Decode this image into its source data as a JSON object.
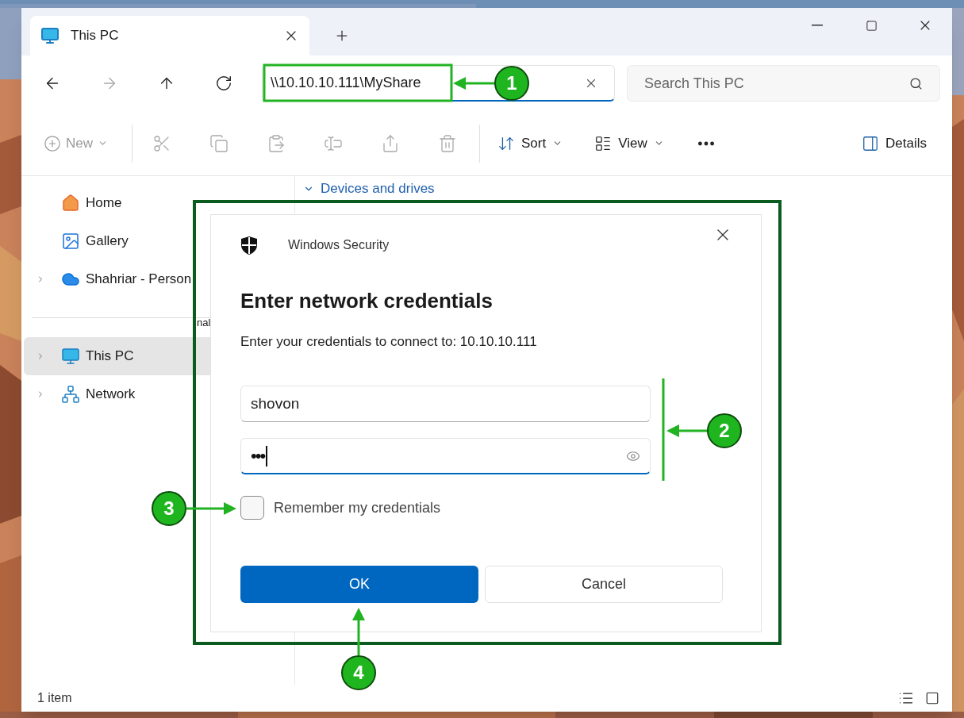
{
  "tab": {
    "title": "This PC",
    "selected": true
  },
  "navigation": [
    {
      "kind": "back",
      "disabled": false
    },
    {
      "kind": "forward",
      "disabled": true
    },
    {
      "kind": "up",
      "disabled": false
    },
    {
      "kind": "refresh",
      "disabled": false
    }
  ],
  "address_bar": {
    "value": "\\\\10.10.10.111\\MyShare",
    "focused": true
  },
  "search": {
    "placeholder": "Search This PC"
  },
  "toolbar": {
    "new": {
      "label": "New",
      "disabled": true
    },
    "actions": [
      {
        "kind": "cut",
        "disabled": true
      },
      {
        "kind": "copy",
        "disabled": true
      },
      {
        "kind": "paste",
        "disabled": true
      },
      {
        "kind": "rename",
        "disabled": true
      },
      {
        "kind": "share",
        "disabled": true
      },
      {
        "kind": "delete",
        "disabled": true
      }
    ],
    "sort": {
      "label": "Sort"
    },
    "view": {
      "label": "View"
    },
    "details": {
      "label": "Details"
    }
  },
  "sidebar": {
    "groups": [
      {
        "items": [
          {
            "kind": "home",
            "label": "Home",
            "expandable": false,
            "selected": false
          },
          {
            "kind": "gallery",
            "label": "Gallery",
            "expandable": false,
            "selected": false
          },
          {
            "kind": "cloud",
            "label": "Shahriar - Person",
            "expandable": true,
            "selected": false
          }
        ]
      },
      {
        "items": [
          {
            "kind": "pc",
            "label": "This PC",
            "expandable": true,
            "selected": true
          },
          {
            "kind": "network",
            "label": "Network",
            "expandable": true,
            "selected": false
          }
        ]
      }
    ]
  },
  "main": {
    "section": {
      "label": "Devices and drives",
      "expanded": true
    },
    "fragment": "nal"
  },
  "dialog": {
    "app": "Windows Security",
    "title": "Enter network credentials",
    "message": "Enter your credentials to connect to: 10.10.10.111",
    "username": {
      "value": "shovon",
      "focused": false
    },
    "password": {
      "value": "•••",
      "focused": true
    },
    "remember": {
      "label": "Remember my credentials",
      "checked": false
    },
    "buttons": [
      {
        "label": "OK",
        "kind": "primary"
      },
      {
        "label": "Cancel",
        "kind": "secondary"
      }
    ]
  },
  "annotations": [
    {
      "number": "1"
    },
    {
      "number": "2"
    },
    {
      "number": "3"
    },
    {
      "number": "4"
    }
  ],
  "status_bar": {
    "count": "1 item"
  }
}
